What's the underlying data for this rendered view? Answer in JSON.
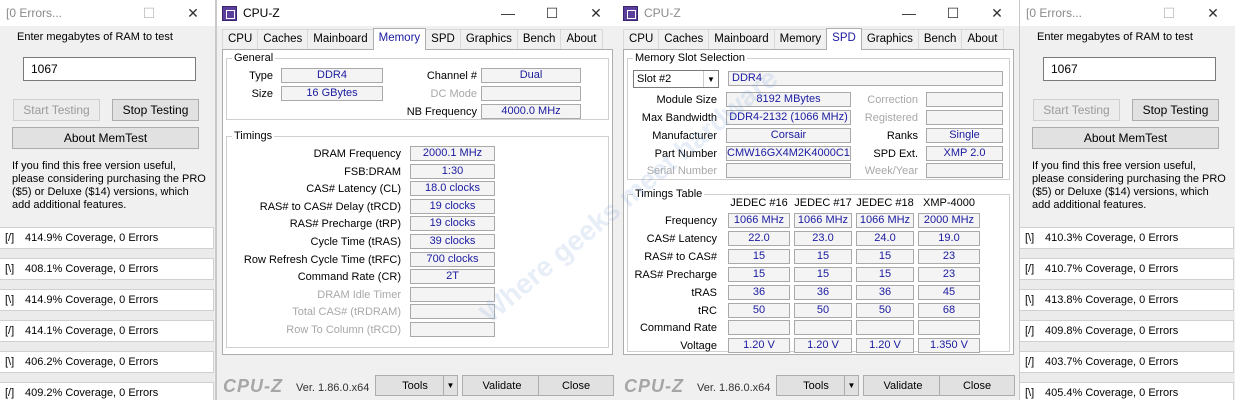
{
  "memtest_left": {
    "title": "[0 Errors...",
    "prompt": "Enter megabytes of RAM to test",
    "ram_value": "1067",
    "start_label": "Start Testing",
    "stop_label": "Stop Testing",
    "about_label": "About MemTest",
    "info_text": "If you find this free version useful, please considering purchasing the PRO ($5) or Deluxe ($14) versions, which add additional features.",
    "coverage": [
      {
        "icon": "[/]",
        "text": "414.9% Coverage, 0 Errors"
      },
      {
        "icon": "[\\]",
        "text": "408.1% Coverage, 0 Errors"
      },
      {
        "icon": "[\\]",
        "text": "414.9% Coverage, 0 Errors"
      },
      {
        "icon": "[/]",
        "text": "414.1% Coverage, 0 Errors"
      },
      {
        "icon": "[\\]",
        "text": "406.2% Coverage, 0 Errors"
      },
      {
        "icon": "[/]",
        "text": "409.2% Coverage, 0 Errors"
      }
    ]
  },
  "memtest_right": {
    "title": "[0 Errors...",
    "prompt": "Enter megabytes of RAM to test",
    "ram_value": "1067",
    "start_label": "Start Testing",
    "stop_label": "Stop Testing",
    "about_label": "About MemTest",
    "info_text": "If you find this free version useful, please considering purchasing the PRO ($5) or Deluxe ($14) versions, which add additional features.",
    "coverage": [
      {
        "icon": "[\\]",
        "text": "410.3% Coverage, 0 Errors"
      },
      {
        "icon": "[/]",
        "text": "410.7% Coverage, 0 Errors"
      },
      {
        "icon": "[\\]",
        "text": "413.8% Coverage, 0 Errors"
      },
      {
        "icon": "[/]",
        "text": "409.8% Coverage, 0 Errors"
      },
      {
        "icon": "[/]",
        "text": "403.7% Coverage, 0 Errors"
      },
      {
        "icon": "[\\]",
        "text": "405.4% Coverage, 0 Errors"
      }
    ]
  },
  "cpuz_tabs": [
    "CPU",
    "Caches",
    "Mainboard",
    "Memory",
    "SPD",
    "Graphics",
    "Bench",
    "About"
  ],
  "cpuz_common": {
    "logo": "CPU-Z",
    "version": "Ver. 1.86.0.x64",
    "tools_label": "Tools",
    "validate_label": "Validate",
    "close_label": "Close",
    "dropdown_glyph": "▼"
  },
  "cpuz_memory": {
    "title": "CPU-Z",
    "active_tab": "Memory",
    "general": {
      "legend": "General",
      "type_label": "Type",
      "type_value": "DDR4",
      "size_label": "Size",
      "size_value": "16 GBytes",
      "channel_label": "Channel #",
      "channel_value": "Dual",
      "dc_label": "DC Mode",
      "dc_value": "",
      "nb_label": "NB Frequency",
      "nb_value": "4000.0 MHz"
    },
    "timings": {
      "legend": "Timings",
      "rows": [
        {
          "label": "DRAM Frequency",
          "value": "2000.1 MHz",
          "dim": false
        },
        {
          "label": "FSB:DRAM",
          "value": "1:30",
          "dim": false
        },
        {
          "label": "CAS# Latency (CL)",
          "value": "18.0 clocks",
          "dim": false
        },
        {
          "label": "RAS# to CAS# Delay (tRCD)",
          "value": "19 clocks",
          "dim": false
        },
        {
          "label": "RAS# Precharge (tRP)",
          "value": "19 clocks",
          "dim": false
        },
        {
          "label": "Cycle Time (tRAS)",
          "value": "39 clocks",
          "dim": false
        },
        {
          "label": "Row Refresh Cycle Time (tRFC)",
          "value": "700 clocks",
          "dim": false
        },
        {
          "label": "Command Rate (CR)",
          "value": "2T",
          "dim": false
        },
        {
          "label": "DRAM Idle Timer",
          "value": "",
          "dim": true
        },
        {
          "label": "Total CAS# (tRDRAM)",
          "value": "",
          "dim": true
        },
        {
          "label": "Row To Column (tRCD)",
          "value": "",
          "dim": true
        }
      ]
    }
  },
  "cpuz_spd": {
    "title": "CPU-Z",
    "active_tab": "SPD",
    "slot": {
      "legend": "Memory Slot Selection",
      "selected_slot": "Slot #2",
      "type_value": "DDR4",
      "module_size_label": "Module Size",
      "module_size_value": "8192 MBytes",
      "max_bw_label": "Max Bandwidth",
      "max_bw_value": "DDR4-2132 (1066 MHz)",
      "manufacturer_label": "Manufacturer",
      "manufacturer_value": "Corsair",
      "part_label": "Part Number",
      "part_value": "CMW16GX4M2K4000C19",
      "serial_label": "Serial Number",
      "serial_value": "",
      "correction_label": "Correction",
      "correction_value": "",
      "registered_label": "Registered",
      "registered_value": "",
      "ranks_label": "Ranks",
      "ranks_value": "Single",
      "spd_ext_label": "SPD Ext.",
      "spd_ext_value": "XMP 2.0",
      "week_label": "Week/Year",
      "week_value": ""
    },
    "table": {
      "legend": "Timings Table",
      "columns": [
        "JEDEC #16",
        "JEDEC #17",
        "JEDEC #18",
        "XMP-4000"
      ],
      "rows": [
        {
          "label": "Frequency",
          "values": [
            "1066 MHz",
            "1066 MHz",
            "1066 MHz",
            "2000 MHz"
          ]
        },
        {
          "label": "CAS# Latency",
          "values": [
            "22.0",
            "23.0",
            "24.0",
            "19.0"
          ]
        },
        {
          "label": "RAS# to CAS#",
          "values": [
            "15",
            "15",
            "15",
            "23"
          ]
        },
        {
          "label": "RAS# Precharge",
          "values": [
            "15",
            "15",
            "15",
            "23"
          ]
        },
        {
          "label": "tRAS",
          "values": [
            "36",
            "36",
            "36",
            "45"
          ]
        },
        {
          "label": "tRC",
          "values": [
            "50",
            "50",
            "50",
            "68"
          ]
        },
        {
          "label": "Command Rate",
          "values": [
            "",
            "",
            "",
            ""
          ]
        },
        {
          "label": "Voltage",
          "values": [
            "1.20 V",
            "1.20 V",
            "1.20 V",
            "1.350 V"
          ]
        }
      ]
    }
  },
  "watermark": "Where geeks meet hardware"
}
